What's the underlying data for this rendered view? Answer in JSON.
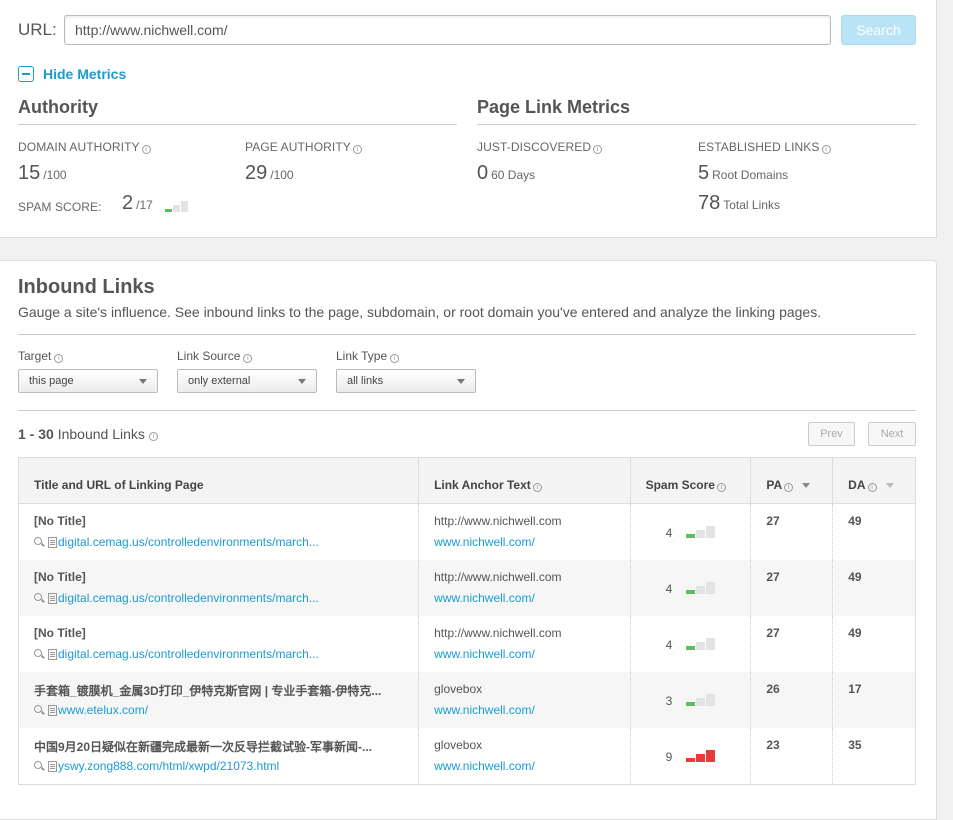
{
  "search": {
    "label": "URL:",
    "value": "http://www.nichwell.com/",
    "button": "Search"
  },
  "toggle": {
    "label": "Hide Metrics"
  },
  "authority": {
    "title": "Authority",
    "domain_authority": {
      "label": "DOMAIN AUTHORITY",
      "value": "15",
      "suffix": "/100"
    },
    "page_authority": {
      "label": "PAGE AUTHORITY",
      "value": "29",
      "suffix": "/100"
    },
    "spam_score": {
      "label": "SPAM SCORE:",
      "value": "2",
      "suffix": "/17"
    }
  },
  "page_link_metrics": {
    "title": "Page Link Metrics",
    "just_discovered": {
      "label": "JUST-DISCOVERED",
      "value": "0",
      "suffix": "60 Days"
    },
    "established": {
      "label": "ESTABLISHED LINKS",
      "root_value": "5",
      "root_suffix": "Root Domains",
      "total_value": "78",
      "total_suffix": "Total Links"
    }
  },
  "inbound": {
    "title": "Inbound Links",
    "description": "Gauge a site's influence. See inbound links to the page, subdomain, or root domain you've entered and analyze the linking pages.",
    "filters": {
      "target": {
        "label": "Target",
        "value": "this page"
      },
      "link_source": {
        "label": "Link Source",
        "value": "only external"
      },
      "link_type": {
        "label": "Link Type",
        "value": "all links"
      }
    },
    "count": {
      "range": "1 - 30",
      "label": "Inbound Links"
    },
    "pager": {
      "prev": "Prev",
      "next": "Next"
    },
    "columns": [
      "Title and URL of Linking Page",
      "Link Anchor Text",
      "Spam Score",
      "PA",
      "DA"
    ],
    "rows": [
      {
        "title": "[No Title]",
        "url": "digital.cemag.us/controlledenvironments/march...",
        "anchor": "http://www.nichwell.com",
        "anchor_url": "www.nichwell.com/",
        "spam": "4",
        "pa": "27",
        "da": "49"
      },
      {
        "title": "[No Title]",
        "url": "digital.cemag.us/controlledenvironments/march...",
        "anchor": "http://www.nichwell.com",
        "anchor_url": "www.nichwell.com/",
        "spam": "4",
        "pa": "27",
        "da": "49"
      },
      {
        "title": "[No Title]",
        "url": "digital.cemag.us/controlledenvironments/march...",
        "anchor": "http://www.nichwell.com",
        "anchor_url": "www.nichwell.com/",
        "spam": "4",
        "pa": "27",
        "da": "49"
      },
      {
        "title": "手套箱_镀膜机_金属3D打印_伊特克斯官网 | 专业手套箱-伊特克...",
        "url": "www.etelux.com/",
        "anchor": "glovebox",
        "anchor_url": "www.nichwell.com/",
        "spam": "3",
        "pa": "26",
        "da": "17"
      },
      {
        "title": "中国9月20日疑似在新疆完成最新一次反导拦截试验-军事新闻-...",
        "url": "yswy.zong888.com/html/xwpd/21073.html",
        "anchor": "glovebox",
        "anchor_url": "www.nichwell.com/",
        "spam": "9",
        "pa": "23",
        "da": "35"
      }
    ]
  },
  "colors": {
    "accent": "#1d9bd1",
    "spam_low": "#5cc15c",
    "spam_high": "#e8393c",
    "bar_empty": "#e3e3e3"
  }
}
